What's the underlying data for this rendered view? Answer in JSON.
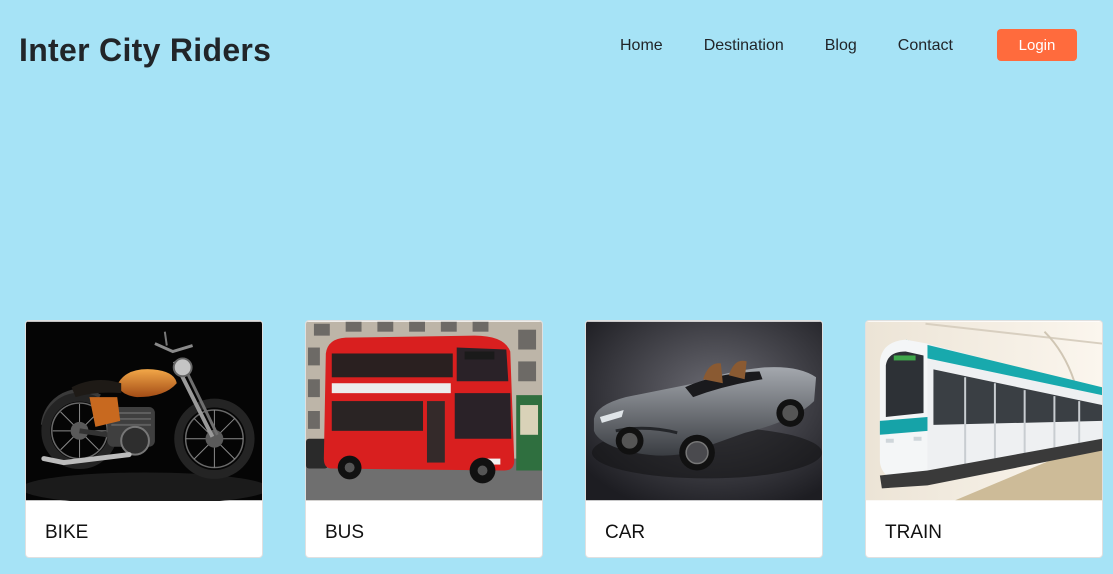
{
  "brand": {
    "name": "Inter City Riders"
  },
  "nav": {
    "items": [
      {
        "label": "Home"
      },
      {
        "label": "Destination"
      },
      {
        "label": "Blog"
      },
      {
        "label": "Contact"
      }
    ],
    "login_label": "Login"
  },
  "colors": {
    "background": "#a6e3f6",
    "accent": "#ff6b3d",
    "text": "#212529",
    "card": "#ffffff"
  },
  "cards": [
    {
      "label": "BIKE",
      "image": "motorcycle-photo"
    },
    {
      "label": "BUS",
      "image": "double-decker-bus-photo"
    },
    {
      "label": "CAR",
      "image": "sports-car-photo"
    },
    {
      "label": "TRAIN",
      "image": "metro-train-photo"
    }
  ]
}
